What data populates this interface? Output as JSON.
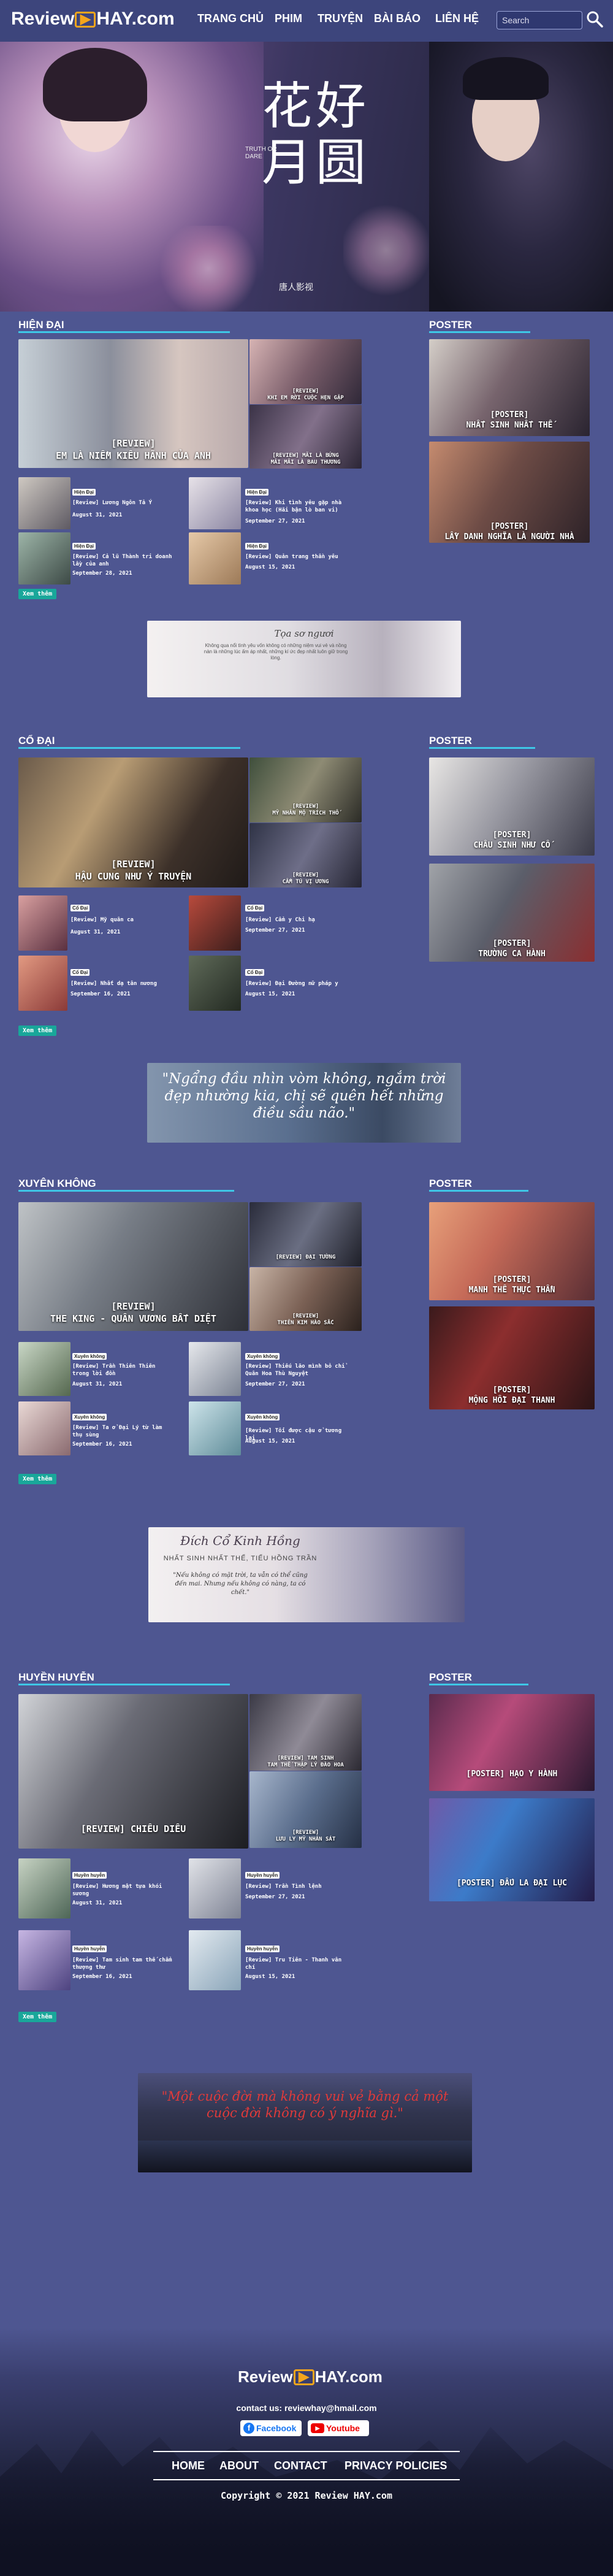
{
  "header": {
    "logo_pre": "Review",
    "logo_tv": "TV",
    "logo_post": "HAY.com",
    "nav": [
      "TRANG CHỦ",
      "PHIM",
      "TRUYỆN",
      "BÀI BÁO",
      "LIÊN HỆ"
    ],
    "search_placeholder": "Search"
  },
  "banner": {
    "title_hanzi": "花好月圆",
    "title_en": "TRUTH OR DARE",
    "studio": "唐人影视"
  },
  "sections": [
    {
      "title": "HIỆN ĐẠI",
      "poster": "POSTER",
      "feature": "[REVIEW]\nEM LÀ NIỀM KIÊU HÃNH CỦA ANH",
      "side1": "[REVIEW]\nKHI EM RỜI CUỘC HẸN GẶP",
      "side2": "[REVIEW] MÃI LÀ BỨNG\nMÃI MÃI LÀ BAU THƯƠNG",
      "cards": [
        {
          "badge": "Hiện Đại",
          "title": "[Review] Lương Ngôn Tả Ý",
          "date": "August 31, 2021"
        },
        {
          "badge": "Hiện Đại",
          "title": "[Review] Khi tình yêu gặp nhà khoa học (Hãi bận lò ban vi)",
          "date": "September 27, 2021"
        },
        {
          "badge": "Hiện Đại",
          "title": "[Review] Cả lũ Thành tri doanh lầy của anh",
          "date": "September 28, 2021"
        },
        {
          "badge": "Hiện Đại",
          "title": "[Review] Quản trang thần yêu",
          "date": "August 15, 2021"
        }
      ],
      "more": "Xem thêm",
      "posters": [
        "[POSTER]\nNHẤT SINH NHẤT THẾ",
        "[POSTER]\nLẦY DANH NGHĨA LÀ NGƯỜI NHÀ"
      ]
    },
    {
      "title": "CỔ ĐẠI",
      "poster": "POSTER",
      "feature": "[REVIEW]\nHẬU CUNG NHƯ Ý TRUYỆN",
      "side1": "[REVIEW]\nMỸ NHÂN MỘ TRÍCH THỐ",
      "side2": "[REVIEW]\nCẨM TÚ VỊ ƯƠNG",
      "cards": [
        {
          "badge": "Cổ Đại",
          "title": "[Review] Mỹ quân ca",
          "date": "August 31, 2021"
        },
        {
          "badge": "Cổ Đại",
          "title": "[Review] Cẩm y Chi hạ",
          "date": "September 27, 2021"
        },
        {
          "badge": "Cổ Đại",
          "title": "[Review] Nhất dạ tân nương",
          "date": "September 16, 2021"
        },
        {
          "badge": "Cổ Đại",
          "title": "[Review] Đại Đường nữ pháp y",
          "date": "August 15, 2021"
        }
      ],
      "more": "Xem thêm",
      "posters": [
        "[POSTER]\nCHÂU SINH NHƯ CỐ",
        "[POSTER]\nTRƯỜNG CA HÀNH"
      ]
    },
    {
      "title": "XUYÊN KHÔNG",
      "poster": "POSTER",
      "feature": "[REVIEW]\nTHE KING - QUÂN VƯƠNG BẤT DIỆT",
      "side1": "[REVIEW] ĐẠI TƯỜNG",
      "side2": "[REVIEW]\nTHIÊN KIM HÀO SẮC",
      "cards": [
        {
          "badge": "Xuyên không",
          "title": "[Review] Trần Thiên Thiên trong lời đồn",
          "date": "August 31, 2021"
        },
        {
          "badge": "Xuyên không",
          "title": "[Review] Thiếu lão mình bỏ chỉ Quân Hoa Thù Nguyệt",
          "date": "September 27, 2021"
        },
        {
          "badge": "Xuyên không",
          "title": "[Review] Ta ở Đại Lý từ làm thụ sùng",
          "date": "September 16, 2021"
        },
        {
          "badge": "Xuyên không",
          "title": "[Review] Tối được cậu ở tương lai",
          "date": "August 15, 2021"
        }
      ],
      "more": "Xem thêm",
      "posters": [
        "[POSTER]\nMANH THÊ THỰC THẦN",
        "[POSTER]\nMỘNG HỒI ĐẠI THANH"
      ]
    },
    {
      "title": "HUYỀN HUYỄN",
      "poster": "POSTER",
      "feature": "[REVIEW] CHIÊU DIÊU",
      "side1": "[REVIEW] TAM SINH\nTAM THẾ THẬP LÝ ĐÀO HOA",
      "side2": "[REVIEW]\nLƯU LY MỸ NHÂN SÁT",
      "cards": [
        {
          "badge": "Huyền huyễn",
          "title": "[Review] Hương mật tựa khói sương",
          "date": "August 31, 2021"
        },
        {
          "badge": "Huyền huyễn",
          "title": "[Review] Trần Tình lệnh",
          "date": "September 27, 2021"
        },
        {
          "badge": "Huyền huyễn",
          "title": "[Review] Tam sinh tam thế chẩm thượng thư",
          "date": "September 16, 2021"
        },
        {
          "badge": "Huyền huyễn",
          "title": "[Review] Tru Tiên - Thanh vân chí",
          "date": "August 15, 2021"
        }
      ],
      "more": "Xem thêm",
      "posters": [
        "[POSTER] HẠO Y HÀNH",
        "[POSTER] ĐẤU LA ĐẠI LỤC"
      ]
    }
  ],
  "quotes": [
    {
      "title": "Tọa sơ ngươi",
      "text": "Không qua nổi tình yêu vốn không có những niệm vui vẻ và nồng nàn là những lúc ấm áp nhất, những kí ức đẹp nhất luôn giữ trong lòng."
    },
    {
      "text": "\"Ngẩng đầu nhìn vòm không, ngắm trời đẹp nhường kia, chị sẽ quên hết những điều sầu não.\""
    },
    {
      "title": "Đích Cổ Kinh Hồng",
      "subtitle": "NHẤT SINH NHẤT THẾ, TIẾU HỒNG TRẦN",
      "text": "\"Nếu không có mặt trời, ta vẫn có thể cũng đến mai. Nhưng nếu không có nàng, ta có chết.\""
    },
    {
      "text": "\"Một cuộc đời mà không vui vẻ bằng cả một cuộc đời không có ý nghĩa gì.\""
    }
  ],
  "footer": {
    "logo_pre": "Review",
    "logo_tv": "TV",
    "logo_post": "HAY.com",
    "contact": "contact us: reviewhay@hmail.com",
    "facebook": "Facebook",
    "youtube": "Youtube",
    "nav": [
      "HOME",
      "ABOUT",
      "CONTACT",
      "PRIVACY POLICIES"
    ],
    "copyright": "Copyright © 2021 Review HAY.com"
  },
  "colors": {
    "bg": "#4e5691",
    "header": "#3d457c",
    "accent": "#3ec7e6",
    "button": "#19a79a",
    "logo_tv": "#f4a51c"
  }
}
